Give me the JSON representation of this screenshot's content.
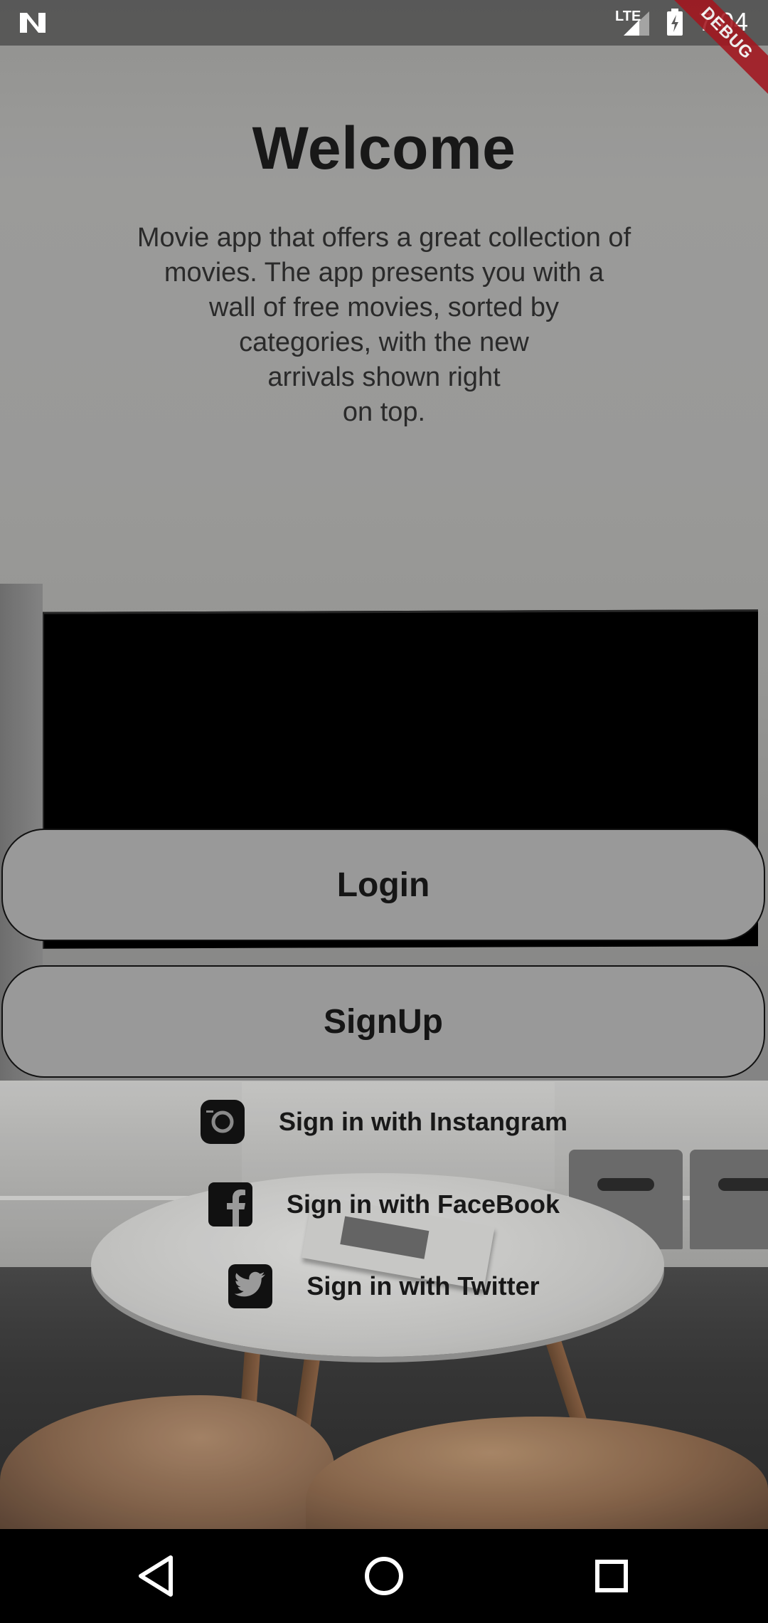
{
  "status_bar": {
    "network_type": "LTE",
    "time": "7:04",
    "debug_ribbon": "DEBUG"
  },
  "welcome": {
    "title": "Welcome",
    "description": "Movie app that offers a great collection of\nmovies. The app presents you with a\nwall of free movies, sorted by\ncategories, with the new\narrivals shown right\non top."
  },
  "buttons": {
    "login": "Login",
    "signup": "SignUp"
  },
  "social": [
    {
      "label": "Sign in with Instangram",
      "icon": "instagram-icon"
    },
    {
      "label": "Sign in with FaceBook",
      "icon": "facebook-icon"
    },
    {
      "label": "Sign in with Twitter",
      "icon": "twitter-icon"
    }
  ],
  "nav_bar": {
    "back_icon": "back-triangle-icon",
    "home_icon": "home-circle-icon",
    "recents_icon": "recents-square-icon"
  }
}
